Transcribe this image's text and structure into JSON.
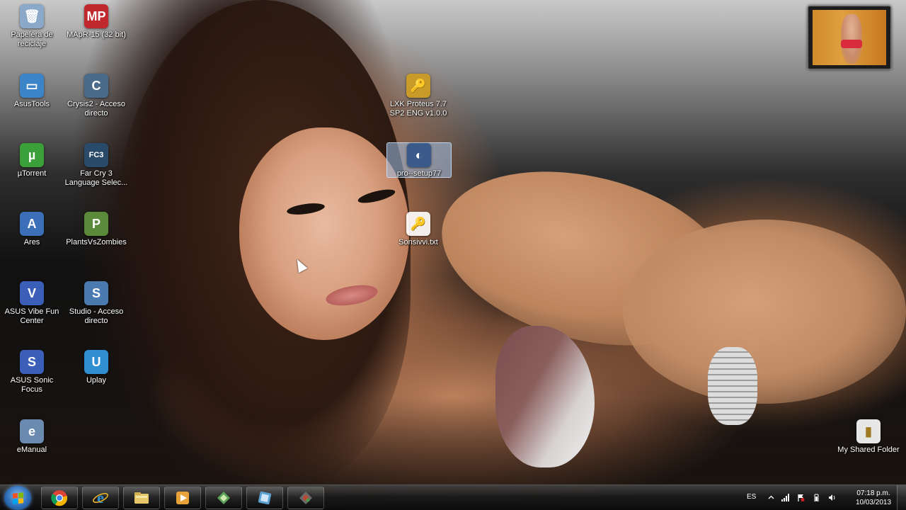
{
  "desktop": {
    "icons": [
      {
        "label": "Papelera de reciclaje",
        "glyph": "🗑",
        "color": "#8aa9c9"
      },
      {
        "label": "MApR-15 (32 bit)",
        "glyph": "MP",
        "color": "#c0282d"
      },
      {
        "label": "AsusTools",
        "glyph": "▭",
        "color": "#3b84c8"
      },
      {
        "label": "Crysis2 - Acceso directo",
        "glyph": "C",
        "color": "#4a6b8a"
      },
      {
        "label": "µTorrent",
        "glyph": "µ",
        "color": "#3aa13a"
      },
      {
        "label": "Far Cry 3 Language Selec...",
        "glyph": "FC3",
        "color": "#2a4a6a"
      },
      {
        "label": "Ares",
        "glyph": "A",
        "color": "#3b6fb8"
      },
      {
        "label": "PlantsVsZombies",
        "glyph": "P",
        "color": "#5a8a3a"
      },
      {
        "label": "ASUS Vibe Fun Center",
        "glyph": "V",
        "color": "#3b5fb8"
      },
      {
        "label": "Studio - Acceso directo",
        "glyph": "S",
        "color": "#4a7ab0"
      },
      {
        "label": "ASUS Sonic Focus",
        "glyph": "S",
        "color": "#3b5fb8"
      },
      {
        "label": "Uplay",
        "glyph": "U",
        "color": "#2f8fd0"
      },
      {
        "label": "eManual",
        "glyph": "e",
        "color": "#6b8ab0"
      },
      {
        "label": "LXK Proteus 7.7 SP2 ENG v1.0.0",
        "glyph": "🔑",
        "color": "#c79a2a"
      },
      {
        "label": "pro--setup77",
        "glyph": "◐",
        "color": "#3a5a8a"
      },
      {
        "label": "Sonsivvi.txt",
        "glyph": "🔑",
        "color": "#dcdcdc"
      },
      {
        "label": "My Shared Folder",
        "glyph": "▮",
        "color": "#e0c060"
      }
    ]
  },
  "taskbar": {
    "apps": [
      {
        "name": "chrome",
        "color": "#e8b22a"
      },
      {
        "name": "internet-explorer",
        "color": "#2f8fd0"
      },
      {
        "name": "file-explorer",
        "color": "#e6c86a"
      },
      {
        "name": "media-player",
        "color": "#e8a23a"
      },
      {
        "name": "app-green",
        "color": "#5aa05a"
      },
      {
        "name": "app-blue",
        "color": "#5aa0d0"
      },
      {
        "name": "app-red",
        "color": "#b84a3a"
      }
    ],
    "tray": {
      "language": "ES",
      "time": "07:18 p.m.",
      "date": "10/03/2013"
    }
  }
}
